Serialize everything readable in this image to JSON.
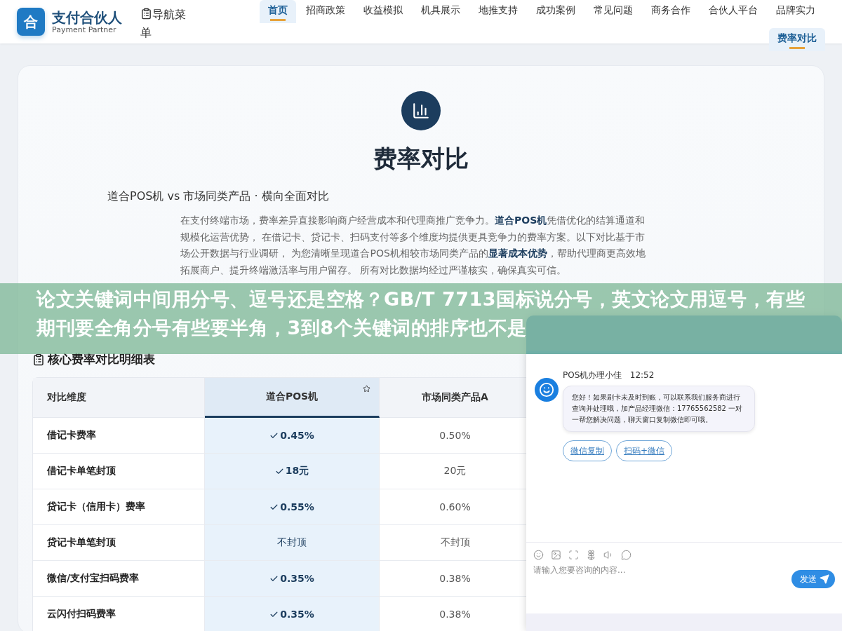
{
  "brand": {
    "logo_letter": "合",
    "name": "支付合伙人",
    "tagline": "Payment Partner"
  },
  "menu_toggle": {
    "label": "导航菜单"
  },
  "nav": [
    {
      "label": "首页",
      "selected": true
    },
    {
      "label": "招商政策",
      "selected": false
    },
    {
      "label": "收益模拟",
      "selected": false
    },
    {
      "label": "机具展示",
      "selected": false
    },
    {
      "label": "地推支持",
      "selected": false
    },
    {
      "label": "成功案例",
      "selected": false
    },
    {
      "label": "常见问题",
      "selected": false
    },
    {
      "label": "商务合作",
      "selected": false
    },
    {
      "label": "合伙人平台",
      "selected": false
    },
    {
      "label": "品牌实力",
      "selected": false
    },
    {
      "label": "费率对比",
      "selected": true
    }
  ],
  "hero": {
    "title": "费率对比",
    "subtitle": "道合POS机 vs 市场同类产品 · 横向全面对比",
    "intro": "在支付终端市场，费率差异直接影响商户经营成本和代理商推广竞争力。**道合POS机**凭借优化的结算通道和规模化运营优势， 在借记卡、贷记卡、扫码支付等多个维度均提供更具竞争力的费率方案。以下对比基于市场公开数据与行业调研， 为您清晰呈现道合POS机相较市场同类产品的**显著成本优势**，帮助代理商更高效地拓展商户、提升终端激活率与用户留存。 所有对比数据均经过严谨核实，确保真实可信。"
  },
  "table": {
    "title": "核心费率对比明细表",
    "columns": [
      {
        "label": "对比维度",
        "highlighted": false
      },
      {
        "label": "道合POS机",
        "highlighted": true
      },
      {
        "label": "市场同类产品A",
        "highlighted": false
      }
    ],
    "rows": [
      {
        "dimension": "借记卡费率",
        "ours": {
          "value": "0.45%",
          "better": true
        },
        "market_a": "0.50%"
      },
      {
        "dimension": "借记卡单笔封顶",
        "ours": {
          "value": "18元",
          "better": true
        },
        "market_a": "20元"
      },
      {
        "dimension": "贷记卡（信用卡）费率",
        "ours": {
          "value": "0.55%",
          "better": true
        },
        "market_a": "0.60%"
      },
      {
        "dimension": "贷记卡单笔封顶",
        "ours": {
          "value": "不封顶",
          "better": false
        },
        "market_a": "不封顶"
      },
      {
        "dimension": "微信/支付宝扫码费率",
        "ours": {
          "value": "0.35%",
          "better": true
        },
        "market_a": "0.38%"
      },
      {
        "dimension": "云闪付扫码费率",
        "ours": {
          "value": "0.35%",
          "better": true
        },
        "market_a": "0.38%"
      }
    ]
  },
  "overlay_banner": {
    "text": "论文关键词中间用分号、逗号还是空格？GB/T 7713国标说分号，英文论文用逗号，有些期刊要全角分号有些要半角，3到8个关键词的排序也不是"
  },
  "chat": {
    "message": {
      "sender": "POS机办理小佳",
      "time": "12:52",
      "text": "您好！如果刷卡未及时到账，可以联系我们服务商进行查询并处理哦，加产品经理微信：17765562582 一对一帮您解决问题，聊天窗口复制微信即可哦。"
    },
    "quick_replies": [
      "微信复制",
      "扫码+微信"
    ],
    "input": {
      "placeholder": "请输入您要咨询的内容..."
    },
    "send_button": "发送"
  }
}
